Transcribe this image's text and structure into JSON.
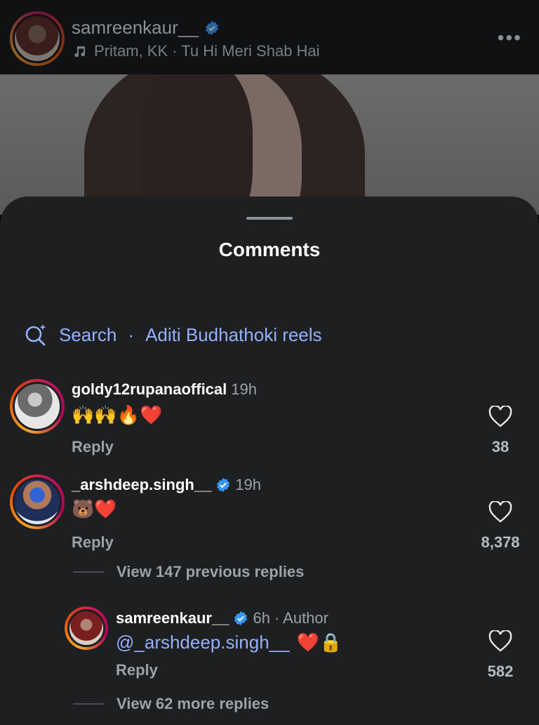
{
  "header": {
    "username": "samreenkaur__",
    "song": "Pritam, KK · Tu Hi Meri Shab Hai",
    "more_label": "•••"
  },
  "sheet": {
    "title": "Comments",
    "search": {
      "label": "Search",
      "separator": "·",
      "query": "Aditi Budhathoki reels"
    }
  },
  "comments": [
    {
      "username": "goldy12rupanaoffical",
      "time": "19h",
      "body": "🙌🙌🔥❤️",
      "reply_label": "Reply",
      "likes": "38",
      "verified": false
    },
    {
      "username": "_arshdeep.singh__",
      "time": "19h",
      "body": "🐻❤️",
      "reply_label": "Reply",
      "likes": "8,378",
      "verified": true,
      "view_previous": "View 147 previous replies",
      "reply": {
        "username": "samreenkaur__",
        "time": "6h",
        "author_label": "· Author",
        "mention": "@_arshdeep.singh__",
        "body_suffix": "❤️🔒",
        "reply_label": "Reply",
        "likes": "582",
        "verified": true
      },
      "view_more": "View 62 more replies"
    }
  ],
  "colors": {
    "sheet_bg": "#1d1f21",
    "link_blue": "#95b0ff",
    "verified_blue": "#3897f0",
    "muted_text": "#9ea2a7"
  }
}
